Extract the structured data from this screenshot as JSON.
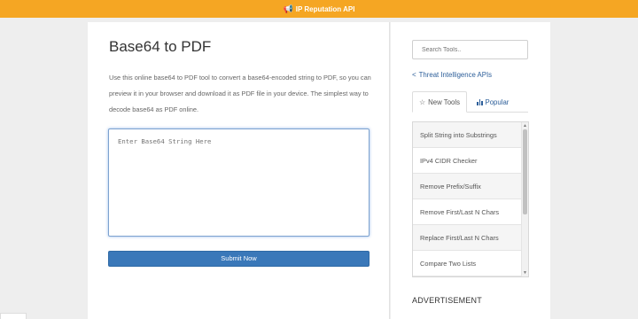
{
  "topbar": {
    "icon": "megaphone-icon",
    "label": "IP Reputation API",
    "color": "#f5a623"
  },
  "main": {
    "title": "Base64 to PDF",
    "description": "Use this online base64 to PDF tool to convert a base64-encoded string to PDF, so you can preview it in your browser and download it as PDF file in your device. The simplest way to decode base64 as PDF online.",
    "input_placeholder": "Enter Base64 String Here",
    "submit_label": "Submit Now",
    "submit_color": "#3a78b9"
  },
  "sidebar": {
    "search_placeholder": "Search Tools..",
    "ti_link": {
      "icon": "share-icon",
      "label": "Threat Intelligence APIs"
    },
    "tabs": [
      {
        "icon": "star-icon",
        "label": "New Tools",
        "active": true
      },
      {
        "icon": "bar-chart-icon",
        "label": "Popular",
        "active": false
      }
    ],
    "tools": [
      "Split String into Substrings",
      "IPv4 CIDR Checker",
      "Remove Prefix/Suffix",
      "Remove First/Last N Chars",
      "Replace First/Last N Chars",
      "Compare Two Lists"
    ],
    "advertisement": "ADVERTISEMENT"
  }
}
